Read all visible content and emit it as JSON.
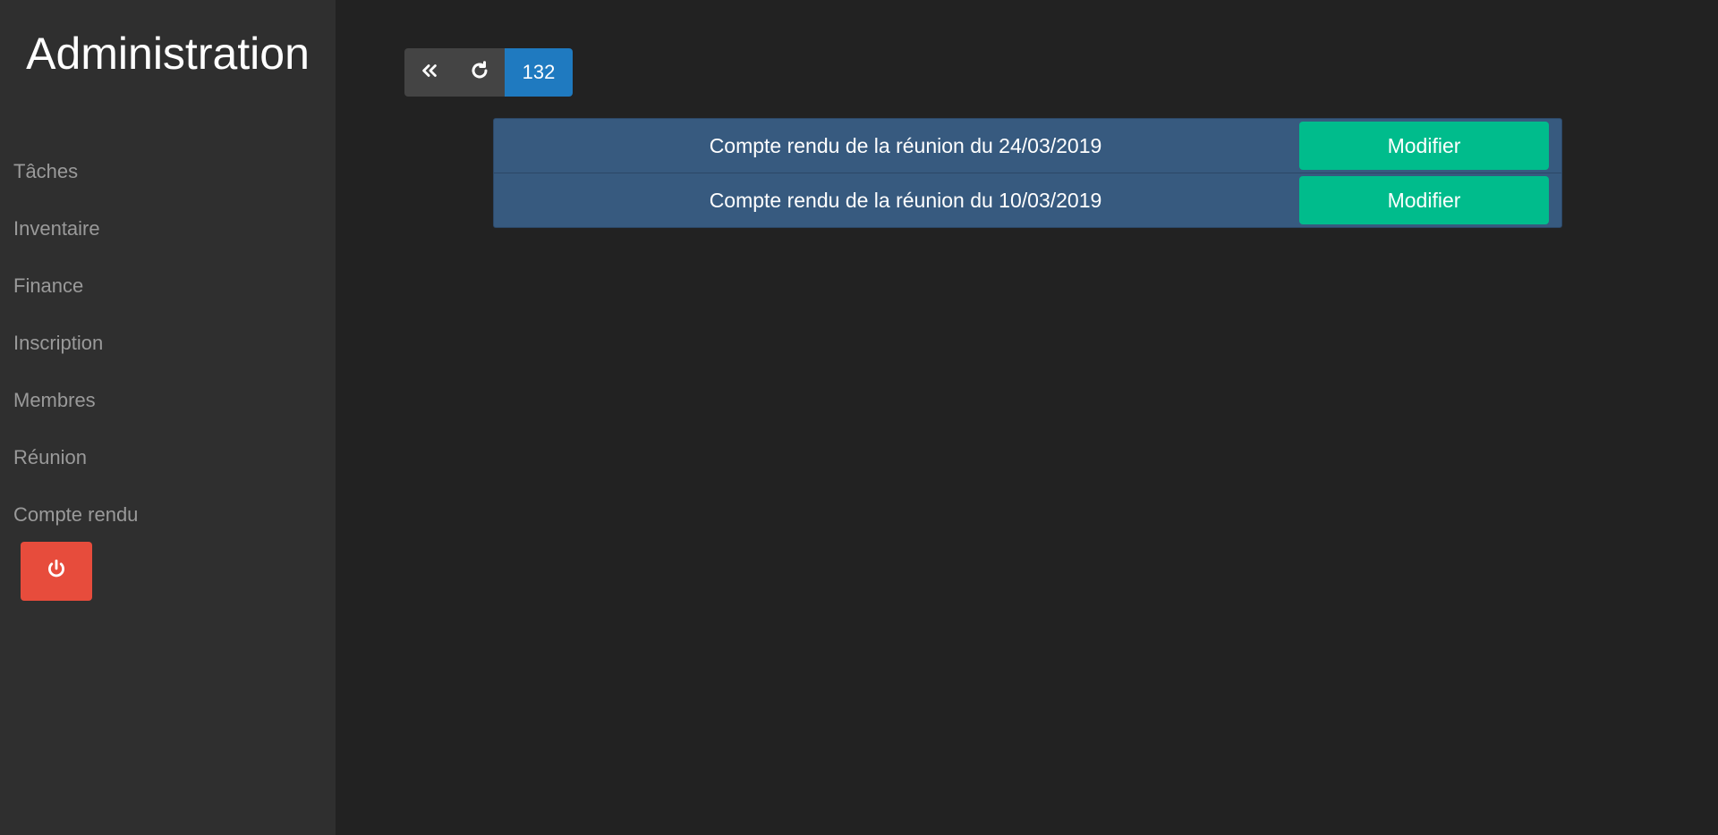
{
  "sidebar": {
    "title": "Administration",
    "items": [
      {
        "label": "Tâches"
      },
      {
        "label": "Inventaire"
      },
      {
        "label": "Finance"
      },
      {
        "label": "Inscription"
      },
      {
        "label": "Membres"
      },
      {
        "label": "Réunion"
      },
      {
        "label": "Compte rendu"
      }
    ],
    "logout_icon": "power-icon"
  },
  "toolbar": {
    "back_icon": "double-chevron-left-icon",
    "refresh_icon": "refresh-icon",
    "count": "132"
  },
  "reports": [
    {
      "title": "Compte rendu de la réunion du 24/03/2019",
      "action": "Modifier"
    },
    {
      "title": "Compte rendu de la réunion du 10/03/2019",
      "action": "Modifier"
    }
  ],
  "colors": {
    "background": "#222222",
    "sidebar": "#2f2f2f",
    "table_row": "#375a7f",
    "modify_button": "#00bc8c",
    "logout_button": "#e74c3c",
    "count_badge": "#1f7ac0"
  }
}
